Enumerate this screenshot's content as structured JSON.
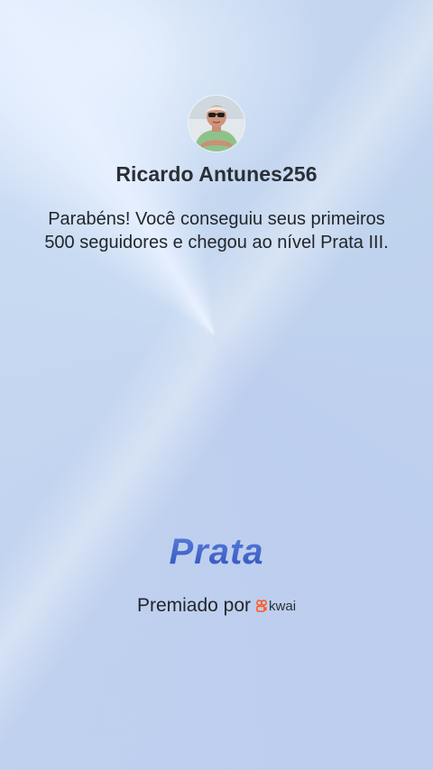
{
  "profile": {
    "name": "Ricardo Antunes256",
    "avatar_icon": "user-avatar"
  },
  "message": "Parabéns! Você conseguiu seus primeiros 500 seguidores e chegou ao nível Prata III.",
  "level": {
    "label": "Prata",
    "color": "#3f63c4"
  },
  "award": {
    "label": "Premiado por",
    "brand_name": "kwai",
    "brand_icon": "kwai-logo-icon",
    "brand_color": "#ff5a1f"
  }
}
